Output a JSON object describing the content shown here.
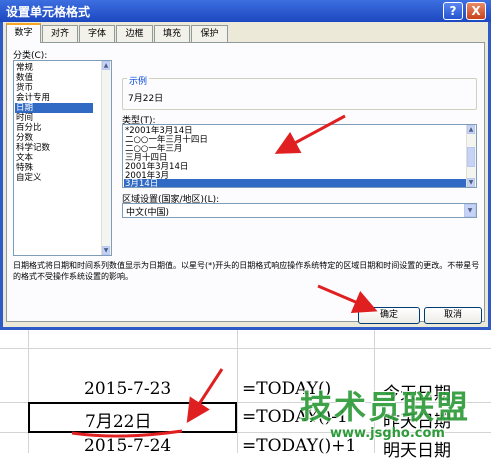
{
  "dialog": {
    "title": "设置单元格格式",
    "help_label": "?",
    "close_label": "X",
    "tabs": [
      "数字",
      "对齐",
      "字体",
      "边框",
      "填充",
      "保护"
    ],
    "category_label": "分类(C):",
    "categories": [
      "常规",
      "数值",
      "货币",
      "会计专用",
      "日期",
      "时间",
      "百分比",
      "分数",
      "科学记数",
      "文本",
      "特殊",
      "自定义"
    ],
    "selected_category": "日期",
    "sample_label": "示例",
    "sample_value": "7月22日",
    "type_label": "类型(T):",
    "types": [
      "*2001年3月14日",
      "二○○一年三月十四日",
      "二○○一年三月",
      "三月十四日",
      "2001年3月14日",
      "2001年3月",
      "3月14日"
    ],
    "selected_type": "3月14日",
    "locale_label": "区域设置(国家/地区)(L):",
    "locale_value": "中文(中国)",
    "description": "日期格式将日期和时间系列数值显示为日期值。以星号(*)开头的日期格式响应操作系统特定的区域日期和时间设置的更改。不带星号的格式不受操作系统设置的影响。",
    "ok_label": "确定",
    "cancel_label": "取消"
  },
  "sheet": {
    "rows": [
      {
        "value": "2015-7-23",
        "formula": "=TODAY()",
        "note": "今天日期"
      },
      {
        "value": "7月22日",
        "formula": "=TODAY()-1",
        "note": "昨天日期"
      },
      {
        "value": "2015-7-24",
        "formula": "=TODAY()+1",
        "note": "明天日期"
      }
    ]
  },
  "watermark": {
    "text": "技术员联盟",
    "url": "www.jsgho.com"
  },
  "colors": {
    "title_bar": "#1c47c0",
    "selection": "#316ac5",
    "annotation_red": "#e02020",
    "watermark_green": "#2e9b3a"
  }
}
